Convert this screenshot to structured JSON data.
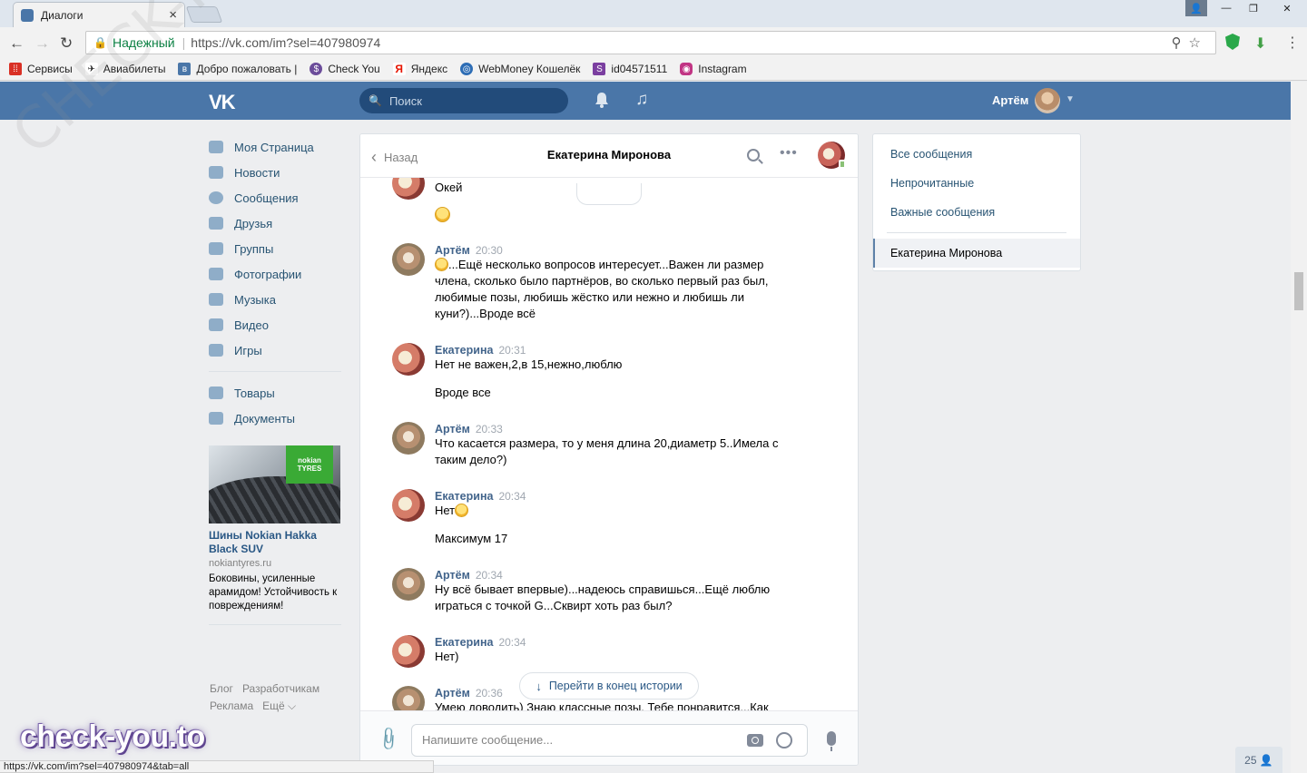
{
  "browser": {
    "tab_title": "Диалоги",
    "tab_close": "×",
    "win_user": "👤",
    "win_min": "—",
    "win_max": "❐",
    "win_close": "✕",
    "secure_label": "Надежный",
    "url": "https://vk.com/im?sel=407980974",
    "status_url": "https://vk.com/im?sel=407980974&tab=all"
  },
  "bookmarks": [
    {
      "label": "Сервисы",
      "icon": "apps-icon",
      "color": "#d93025"
    },
    {
      "label": "Авиабилеты",
      "icon": "plane-icon",
      "color": "#222222"
    },
    {
      "label": "Добро пожаловать |",
      "icon": "vk-icon",
      "color": "#4a76a8"
    },
    {
      "label": "Check You",
      "icon": "check-you-icon",
      "color": "#6b4c9a"
    },
    {
      "label": "Яндекс",
      "icon": "yandex-icon",
      "color": "#e61400"
    },
    {
      "label": "WebMoney Кошелёк",
      "icon": "webmoney-icon",
      "color": "#2d6db5"
    },
    {
      "label": "id04571511",
      "icon": "s-icon",
      "color": "#7b3fa0"
    },
    {
      "label": "Instagram",
      "icon": "instagram-icon",
      "color": "#c13584"
    }
  ],
  "vk": {
    "logo": "VK",
    "search_placeholder": "Поиск",
    "user_name": "Артём"
  },
  "left_menu": {
    "items": [
      {
        "label": "Моя Страница",
        "icon": "home-icon"
      },
      {
        "label": "Новости",
        "icon": "news-icon"
      },
      {
        "label": "Сообщения",
        "icon": "messages-icon"
      },
      {
        "label": "Друзья",
        "icon": "friends-icon"
      },
      {
        "label": "Группы",
        "icon": "groups-icon"
      },
      {
        "label": "Фотографии",
        "icon": "photos-icon"
      },
      {
        "label": "Музыка",
        "icon": "music-icon"
      },
      {
        "label": "Видео",
        "icon": "video-icon"
      },
      {
        "label": "Игры",
        "icon": "games-icon"
      }
    ],
    "items2": [
      {
        "label": "Товары",
        "icon": "goods-icon"
      },
      {
        "label": "Документы",
        "icon": "documents-icon"
      }
    ],
    "ad": {
      "brand": "nokian",
      "brand2": "TYRES",
      "title": "Шины Nokian Hakka Black SUV",
      "site": "nokiantyres.ru",
      "text": "Боковины, усиленные арамидом! Устойчивость к повреждениям!"
    },
    "footer": {
      "blog": "Блог",
      "dev": "Разработчикам",
      "ads": "Реклама",
      "more": "Ещё ⌵"
    }
  },
  "chat": {
    "back_label": "Назад",
    "peer_name": "Екатерина Миронова",
    "messages": [
      {
        "author": "",
        "time": "",
        "text": "Окей"
      },
      {
        "author": "Артём",
        "time": "20:30",
        "text": "...Ещё несколько вопросов интересует...Важен ли размер\nчлена, сколько было партнёров, во сколько первый раз был,\nлюбимые позы, любишь жёстко или нежно и любишь ли\nкуни?)...Вроде всё"
      },
      {
        "author": "Екатерина",
        "time": "20:31",
        "text": "Нет не важен,2,в 15,нежно,люблю",
        "text2": "Вроде все"
      },
      {
        "author": "Артём",
        "time": "20:33",
        "text": "Что касается размера, то у меня длина 20,диаметр 5..Имела с\nтаким дело?)"
      },
      {
        "author": "Екатерина",
        "time": "20:34",
        "text": "Нет",
        "text2": "Максимум 17"
      },
      {
        "author": "Артём",
        "time": "20:34",
        "text": "Ну всё бывает впервые)...надеюсь справишься...Ещё люблю\nиграться с точкой G...Сквирт хоть раз был?"
      },
      {
        "author": "Екатерина",
        "time": "20:34",
        "text": "Нет)"
      },
      {
        "author": "Артём",
        "time": "20:36",
        "text": "Умею доводить) Знаю классные позы. Тебе понравится...Как"
      }
    ],
    "goto_end": "Перейти в конец истории",
    "composer_placeholder": "Напишите сообщение..."
  },
  "right_panel": {
    "all": "Все сообщения",
    "unread": "Непрочитанные",
    "important": "Важные сообщения",
    "active": "Екатерина Миронова"
  },
  "counter": "25",
  "watermark": "check-you.to",
  "watermark_diag": "CHECK-YOU.ME"
}
